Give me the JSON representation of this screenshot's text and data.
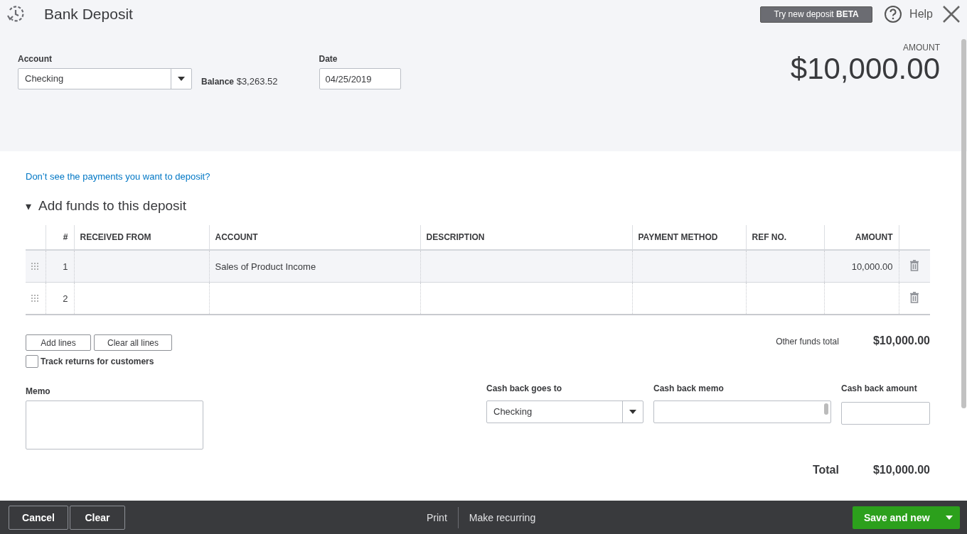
{
  "window": {
    "title": "Bank Deposit"
  },
  "header_actions": {
    "beta_button": "Try new deposit **BETA**",
    "help": "Help"
  },
  "account": {
    "label": "Account",
    "value": "Checking",
    "balance_label": "Balance",
    "balance": "$3,263.52"
  },
  "date": {
    "label": "Date",
    "value": "04/25/2019"
  },
  "amount": {
    "label": "AMOUNT",
    "value": "$10,000.00"
  },
  "payments_link": "Don’t see the payments you want to deposit?",
  "section": {
    "title": "Add funds to this deposit",
    "toggle": "▾",
    "expanded": true
  },
  "table": {
    "columns": [
      "#",
      "RECEIVED FROM",
      "ACCOUNT",
      "DESCRIPTION",
      "PAYMENT METHOD",
      "REF NO.",
      "AMOUNT"
    ],
    "rows": [
      {
        "number": "1",
        "received_from": "",
        "account": "Sales of Product Income",
        "description": "",
        "payment_method": "",
        "ref_no": "",
        "amount": "10,000.00",
        "selected": true
      },
      {
        "number": "2",
        "received_from": "",
        "account": "",
        "description": "",
        "payment_method": "",
        "ref_no": "",
        "amount": "",
        "selected": false
      }
    ]
  },
  "line_buttons": [
    "Add lines",
    "Clear all lines"
  ],
  "track_returns": {
    "label": "Track returns for customers",
    "checked": false
  },
  "other_funds_total": {
    "label": "Other funds total",
    "value": "$10,000.00"
  },
  "memo": {
    "label": "Memo"
  },
  "cash_back": {
    "goes_to_label": "Cash back goes to",
    "goes_to_value": "Checking",
    "memo_label": "Cash back memo",
    "amount_label": "Cash back amount"
  },
  "total": {
    "label": "Total",
    "value": "$10,000.00"
  },
  "footer": {
    "left_buttons": [
      "Cancel",
      "Clear"
    ],
    "center_links": [
      "Print",
      "Make recurring"
    ],
    "primary_button": "Save and new"
  }
}
